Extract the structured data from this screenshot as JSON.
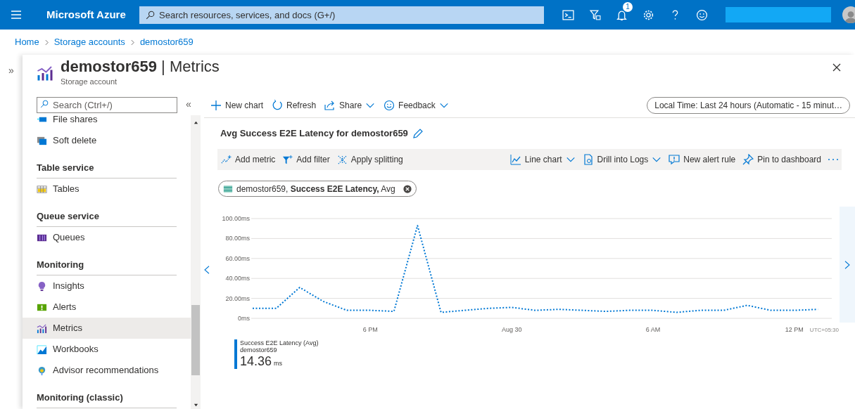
{
  "topbar": {
    "brand": "Microsoft Azure",
    "search_placeholder": "Search resources, services, and docs (G+/)",
    "notification_count": "1"
  },
  "breadcrumb": [
    "Home",
    "Storage accounts",
    "demostor659"
  ],
  "blade": {
    "title": "**demostor659** | Metrics",
    "subtitle": "Storage account",
    "collapse_glyph": "»"
  },
  "sidebar": {
    "search_placeholder": "Search (Ctrl+/)",
    "collapse_glyph": "«",
    "items": [
      {
        "kind": "item",
        "label": "File shares",
        "selected": false
      },
      {
        "kind": "item",
        "label": "Soft delete",
        "selected": false
      },
      {
        "kind": "header",
        "label": "Table service"
      },
      {
        "kind": "item",
        "label": "Tables",
        "selected": false
      },
      {
        "kind": "header",
        "label": "Queue service"
      },
      {
        "kind": "item",
        "label": "Queues",
        "selected": false
      },
      {
        "kind": "header",
        "label": "Monitoring"
      },
      {
        "kind": "item",
        "label": "Insights",
        "selected": false
      },
      {
        "kind": "item",
        "label": "Alerts",
        "selected": false
      },
      {
        "kind": "item",
        "label": "Metrics",
        "selected": true
      },
      {
        "kind": "item",
        "label": "Workbooks",
        "selected": false
      },
      {
        "kind": "item",
        "label": "Advisor recommendations",
        "selected": false
      },
      {
        "kind": "header",
        "label": "Monitoring (classic)"
      }
    ]
  },
  "toolbar": [
    {
      "label": "New chart",
      "dropdown": false
    },
    {
      "label": "Refresh",
      "dropdown": false
    },
    {
      "label": "Share",
      "dropdown": true
    },
    {
      "label": "Feedback",
      "dropdown": true
    }
  ],
  "time_range": "Local Time: Last 24 hours (Automatic - 15 minut…",
  "chart_title": "Avg Success E2E Latency for demostor659",
  "chart_toolbar_left": [
    {
      "label": "Add metric",
      "dropdown": false
    },
    {
      "label": "Add filter",
      "dropdown": false
    },
    {
      "label": "Apply splitting",
      "dropdown": false
    }
  ],
  "chart_toolbar_right": [
    {
      "label": "Line chart",
      "dropdown": true
    },
    {
      "label": "Drill into Logs",
      "dropdown": true
    },
    {
      "label": "New alert rule",
      "dropdown": false
    },
    {
      "label": "Pin to dashboard",
      "dropdown": false
    }
  ],
  "metric_pill": "demostor659, **Success E2E Latency,** Avg",
  "timezone": "UTC+05:30",
  "chart_data": {
    "type": "line",
    "grid": true,
    "categories": [
      null,
      null,
      null,
      null,
      null,
      "6 PM",
      null,
      null,
      null,
      null,
      null,
      "Aug 30",
      null,
      null,
      null,
      null,
      null,
      "6 AM",
      null,
      null,
      null,
      null,
      null,
      "12 PM",
      null
    ],
    "series": [
      {
        "name": "Success E2E Latency (Avg)",
        "color": "#0078d4",
        "line_style": "dotted",
        "values": [
          10,
          10,
          31,
          17,
          8,
          8,
          7,
          93,
          6,
          8,
          10,
          11,
          8,
          9,
          8,
          7,
          8,
          8,
          6,
          8,
          8,
          13,
          8,
          8,
          9
        ]
      }
    ],
    "ylim": [
      0,
      100
    ],
    "yticks": [
      {
        "value": 0,
        "label": "0ms"
      },
      {
        "value": 20,
        "label": "20.00ms"
      },
      {
        "value": 40,
        "label": "40.00ms"
      },
      {
        "value": 60,
        "label": "60.00ms"
      },
      {
        "value": 80,
        "label": "80.00ms"
      },
      {
        "value": 100,
        "label": "100.00ms"
      }
    ]
  },
  "legend": {
    "resource": "demostor659",
    "value": "14.36",
    "unit": "ms"
  }
}
